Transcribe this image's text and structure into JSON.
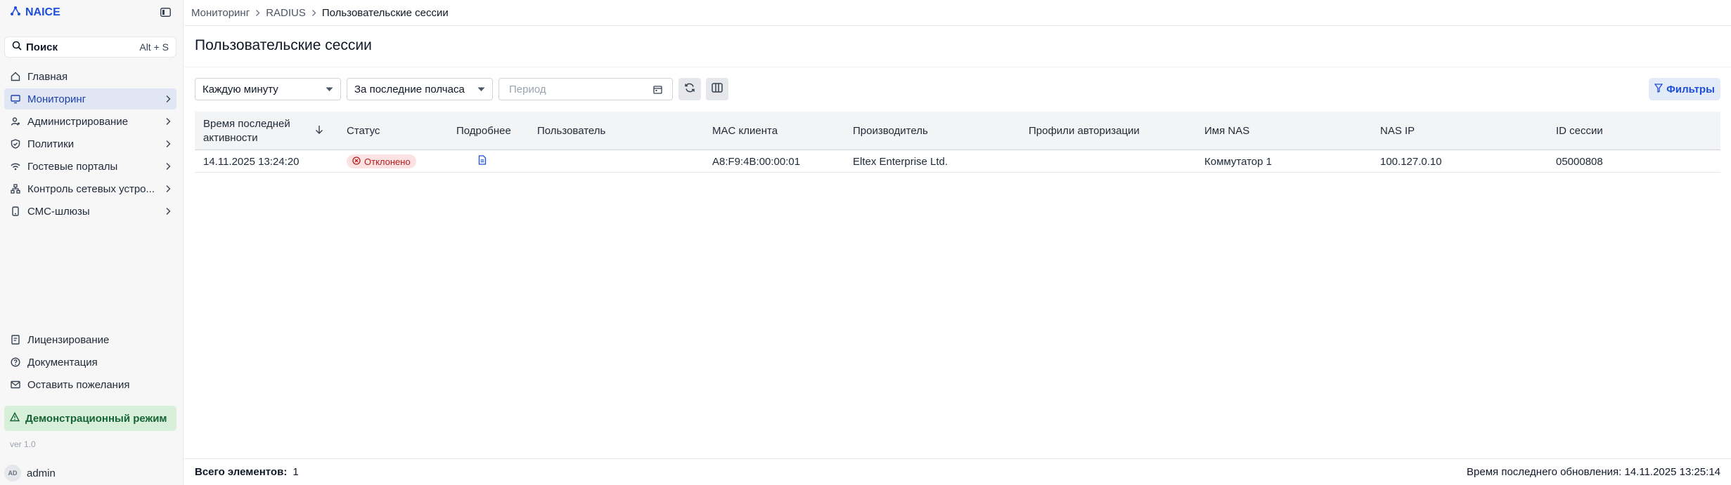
{
  "app": {
    "name": "NAICE"
  },
  "search": {
    "label": "Поиск",
    "hotkey": "Alt + S"
  },
  "sidebar": {
    "items": [
      {
        "label": "Главная",
        "icon": "home-icon"
      },
      {
        "label": "Мониторинг",
        "icon": "monitor-icon",
        "active": true
      },
      {
        "label": "Администрирование",
        "icon": "admin-icon"
      },
      {
        "label": "Политики",
        "icon": "shield-icon"
      },
      {
        "label": "Гостевые порталы",
        "icon": "portal-icon"
      },
      {
        "label": "Контроль сетевых устро...",
        "icon": "network-icon"
      },
      {
        "label": "СМС-шлюзы",
        "icon": "phone-icon"
      }
    ],
    "bottom": [
      {
        "label": "Лицензирование",
        "icon": "license-icon"
      },
      {
        "label": "Документация",
        "icon": "help-icon"
      },
      {
        "label": "Оставить пожелания",
        "icon": "mail-icon"
      }
    ],
    "demo_label": "Демонстрационный режим",
    "version": "ver 1.0",
    "user": {
      "initials": "AD",
      "name": "admin"
    }
  },
  "breadcrumb": [
    "Мониторинг",
    "RADIUS",
    "Пользовательские сессии"
  ],
  "page": {
    "title": "Пользовательские сессии"
  },
  "toolbar": {
    "refresh_interval": "Каждую минуту",
    "time_range": "За последние полчаса",
    "period_placeholder": "Период",
    "filters_label": "Фильтры"
  },
  "table": {
    "columns": [
      "Время последней активности",
      "Статус",
      "Подробнее",
      "Пользователь",
      "MAC клиента",
      "Производитель",
      "Профили авторизации",
      "Имя NAS",
      "NAS IP",
      "ID сессии"
    ],
    "rows": [
      {
        "last_activity": "14.11.2025 13:24:20",
        "status": "Отклонено",
        "user": "",
        "mac": "A8:F9:4B:00:00:01",
        "vendor": "Eltex Enterprise Ltd.",
        "auth_profiles": "",
        "nas_name": "Коммутатор 1",
        "nas_ip": "100.127.0.10",
        "session_id": "05000808"
      }
    ]
  },
  "footer": {
    "total_label": "Всего элементов:",
    "total_value": "1",
    "updated": "Время последнего обновления: 14.11.2025 13:25:14"
  },
  "colors": {
    "accent": "#1d4ed8",
    "active_bg": "#e0e6f4",
    "demo_bg": "#d8efd9",
    "rejected_bg": "#fde2e4",
    "rejected_text": "#b91c1c"
  }
}
